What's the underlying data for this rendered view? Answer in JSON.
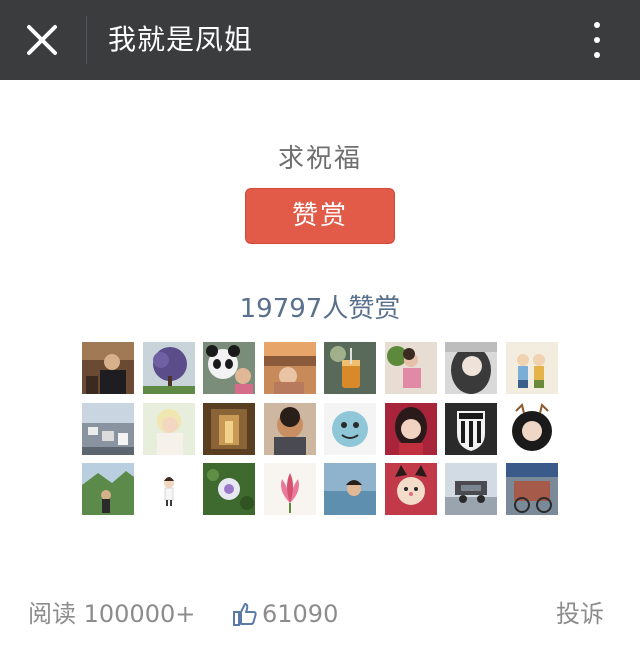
{
  "header": {
    "title": "我就是凤姐",
    "close_icon": "close-icon",
    "more_icon": "more-vertical-icon",
    "background_color": "#3b3c3e"
  },
  "reward": {
    "prompt": "求祝福",
    "button_label": "赞赏",
    "button_color": "#e25b49",
    "count_text": "19797人赞赏",
    "count_color": "#59708d"
  },
  "avatars": [
    {
      "name": "avatar-1"
    },
    {
      "name": "avatar-2"
    },
    {
      "name": "avatar-3"
    },
    {
      "name": "avatar-4"
    },
    {
      "name": "avatar-5"
    },
    {
      "name": "avatar-6"
    },
    {
      "name": "avatar-7"
    },
    {
      "name": "avatar-8"
    },
    {
      "name": "avatar-9"
    },
    {
      "name": "avatar-10"
    },
    {
      "name": "avatar-11"
    },
    {
      "name": "avatar-12"
    },
    {
      "name": "avatar-13"
    },
    {
      "name": "avatar-14"
    },
    {
      "name": "avatar-15"
    },
    {
      "name": "avatar-16"
    },
    {
      "name": "avatar-17"
    },
    {
      "name": "avatar-18"
    },
    {
      "name": "avatar-19"
    },
    {
      "name": "avatar-20"
    },
    {
      "name": "avatar-21"
    },
    {
      "name": "avatar-22"
    },
    {
      "name": "avatar-23"
    },
    {
      "name": "avatar-24"
    }
  ],
  "footer": {
    "read_text": "阅读 100000+",
    "like_icon": "thumbs-up-icon",
    "like_count": "61090",
    "report_label": "投诉"
  }
}
